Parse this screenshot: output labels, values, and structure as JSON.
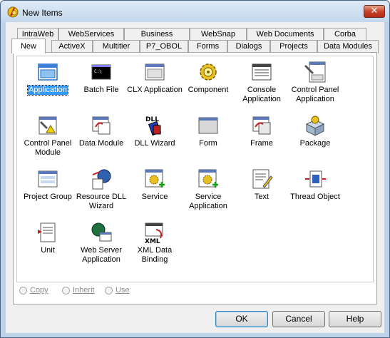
{
  "window": {
    "title": "New Items",
    "close_glyph": "✕"
  },
  "tabs_back": [
    "IntraWeb",
    "WebServices",
    "Business",
    "WebSnap",
    "Web Documents",
    "Corba"
  ],
  "tabs_front": [
    "New",
    "ActiveX",
    "Multitier",
    "P7_OBOL",
    "Forms",
    "Dialogs",
    "Projects",
    "Data Modules"
  ],
  "active_tab": "New",
  "items": [
    {
      "label": "Application",
      "icon": "application-icon",
      "selected": true
    },
    {
      "label": "Batch File",
      "icon": "batch-file-icon"
    },
    {
      "label": "CLX Application",
      "icon": "clx-application-icon"
    },
    {
      "label": "Component",
      "icon": "component-gear-icon"
    },
    {
      "label": "Console Application",
      "icon": "console-application-icon"
    },
    {
      "label": "Control Panel Application",
      "icon": "control-panel-application-icon"
    },
    {
      "label": "Control Panel Module",
      "icon": "control-panel-module-icon"
    },
    {
      "label": "Data Module",
      "icon": "data-module-icon"
    },
    {
      "label": "DLL Wizard",
      "icon": "dll-wizard-icon",
      "icon_text": "DLL"
    },
    {
      "label": "Form",
      "icon": "form-icon"
    },
    {
      "label": "Frame",
      "icon": "frame-icon"
    },
    {
      "label": "Package",
      "icon": "package-icon"
    },
    {
      "label": "Project Group",
      "icon": "project-group-icon"
    },
    {
      "label": "Resource DLL Wizard",
      "icon": "resource-dll-wizard-icon"
    },
    {
      "label": "Service",
      "icon": "service-icon"
    },
    {
      "label": "Service Application",
      "icon": "service-application-icon"
    },
    {
      "label": "Text",
      "icon": "text-icon"
    },
    {
      "label": "Thread Object",
      "icon": "thread-object-icon"
    },
    {
      "label": "Unit",
      "icon": "unit-icon"
    },
    {
      "label": "Web Server Application",
      "icon": "web-server-application-icon"
    },
    {
      "label": "XML Data Binding",
      "icon": "xml-data-binding-icon",
      "icon_text": "XML"
    }
  ],
  "options": {
    "copy": "Copy",
    "inherit": "Inherit",
    "use": "Use"
  },
  "buttons": {
    "ok": "OK",
    "cancel": "Cancel",
    "help": "Help"
  },
  "colors": {
    "selection": "#3399ff",
    "close": "#c8432a",
    "frame": "#bcd3ea"
  }
}
